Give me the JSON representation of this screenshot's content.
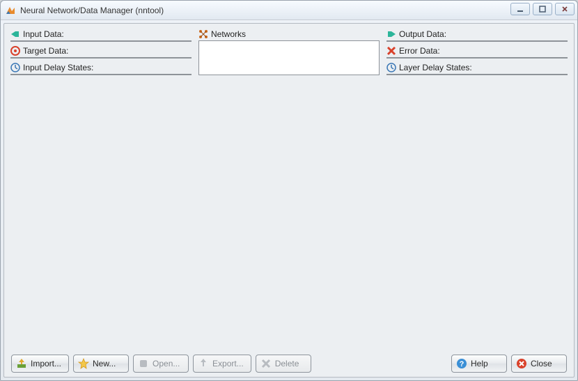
{
  "window": {
    "title": "Neural Network/Data Manager (nntool)"
  },
  "panels": {
    "input_data": {
      "label": "Input Data:"
    },
    "target_data": {
      "label": "Target Data:"
    },
    "input_delay": {
      "label": "Input Delay States:"
    },
    "networks": {
      "label": "Networks"
    },
    "output_data": {
      "label": "Output Data:"
    },
    "error_data": {
      "label": "Error Data:"
    },
    "layer_delay": {
      "label": "Layer Delay States:"
    }
  },
  "buttons": {
    "import": "Import...",
    "new": "New...",
    "open": "Open...",
    "export": "Export...",
    "delete": "Delete",
    "help": "Help",
    "close": "Close"
  },
  "button_states": {
    "import": "enabled",
    "new": "enabled",
    "open": "disabled",
    "export": "disabled",
    "delete": "disabled",
    "help": "enabled",
    "close": "enabled"
  }
}
